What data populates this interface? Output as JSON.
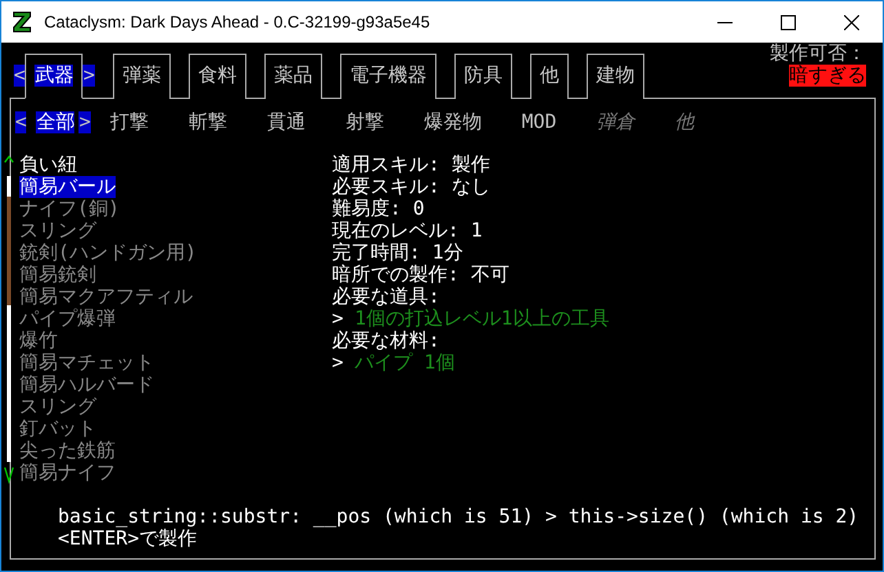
{
  "window": {
    "title": "Cataclysm: Dark Days Ahead - 0.C-32199-g93a5e45"
  },
  "tabs": [
    {
      "label": "武器",
      "selected": true
    },
    {
      "label": "弾薬",
      "selected": false
    },
    {
      "label": "食料",
      "selected": false
    },
    {
      "label": "薬品",
      "selected": false
    },
    {
      "label": "電子機器",
      "selected": false
    },
    {
      "label": "防具",
      "selected": false
    },
    {
      "label": "他",
      "selected": false
    },
    {
      "label": "建物",
      "selected": false
    }
  ],
  "tab_markers": {
    "prev": "<",
    "next": ">"
  },
  "subtab_markers": {
    "prev": "<",
    "next": ">"
  },
  "craftability": {
    "label": "製作可否：",
    "value": "暗すぎる"
  },
  "subtabs": [
    {
      "label": "全部",
      "selected": true,
      "disabled": false
    },
    {
      "label": "打撃",
      "selected": false,
      "disabled": false
    },
    {
      "label": "斬撃",
      "selected": false,
      "disabled": false
    },
    {
      "label": "貫通",
      "selected": false,
      "disabled": false
    },
    {
      "label": "射撃",
      "selected": false,
      "disabled": false
    },
    {
      "label": "爆発物",
      "selected": false,
      "disabled": false
    },
    {
      "label": "MOD",
      "selected": false,
      "disabled": false
    },
    {
      "label": "弾倉",
      "selected": false,
      "disabled": true
    },
    {
      "label": "他",
      "selected": false,
      "disabled": true
    }
  ],
  "recipes": [
    {
      "name": "負い紐",
      "selected": false,
      "available": true
    },
    {
      "name": "簡易バール",
      "selected": true,
      "available": true
    },
    {
      "name": "ナイフ(銅)",
      "selected": false,
      "available": false
    },
    {
      "name": "スリング",
      "selected": false,
      "available": false
    },
    {
      "name": "銃剣(ハンドガン用)",
      "selected": false,
      "available": false
    },
    {
      "name": "簡易銃剣",
      "selected": false,
      "available": false
    },
    {
      "name": "簡易マクアフティル",
      "selected": false,
      "available": false
    },
    {
      "name": "パイプ爆弾",
      "selected": false,
      "available": false
    },
    {
      "name": "爆竹",
      "selected": false,
      "available": false
    },
    {
      "name": "簡易マチェット",
      "selected": false,
      "available": false
    },
    {
      "name": "簡易ハルバード",
      "selected": false,
      "available": false
    },
    {
      "name": "スリング",
      "selected": false,
      "available": false
    },
    {
      "name": "釘バット",
      "selected": false,
      "available": false
    },
    {
      "name": "尖った鉄筋",
      "selected": false,
      "available": false
    },
    {
      "name": "簡易ナイフ",
      "selected": false,
      "available": false
    }
  ],
  "details": [
    {
      "kind": "line",
      "text": "適用スキル: 製作"
    },
    {
      "kind": "line",
      "text": "必要スキル: なし"
    },
    {
      "kind": "line",
      "text": "難易度: 0"
    },
    {
      "kind": "line",
      "text": "現在のレベル: 1"
    },
    {
      "kind": "line",
      "text": "完了時間: 1分"
    },
    {
      "kind": "line",
      "text": "暗所での製作: 不可"
    },
    {
      "kind": "line",
      "text": "必要な道具:"
    },
    {
      "kind": "requirement",
      "marker": ">",
      "text": "1個の打込レベル1以上の工具"
    },
    {
      "kind": "line",
      "text": "必要な材料:"
    },
    {
      "kind": "requirement",
      "marker": ">",
      "text": "パイプ 1個"
    }
  ],
  "error_message": "basic_string::substr: __pos (which is 51) > this->size() (which is 2)",
  "hint": "<ENTER>で製作"
}
